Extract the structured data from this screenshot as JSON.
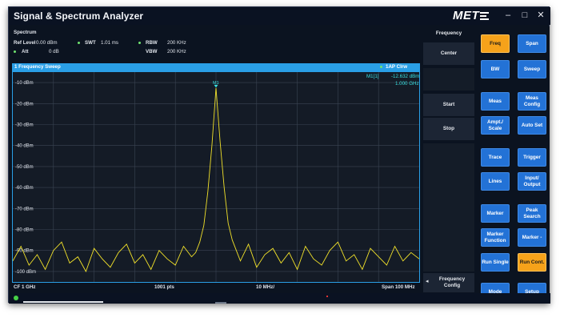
{
  "app": {
    "title": "Signal & Spectrum Analyzer",
    "logo_text": "MET"
  },
  "window_controls": {
    "minimize": "–",
    "maximize": "□",
    "close": "✕"
  },
  "info": {
    "panel_title": "Spectrum",
    "ref_level_label": "Ref Level",
    "ref_level_value": "0.00 dBm",
    "att_label": "Att",
    "att_value": "0 dB",
    "swt_label": "SWT",
    "swt_value": "1.01 ms",
    "rbw_label": "RBW",
    "rbw_value": "200 KHz",
    "vbw_label": "VBW",
    "vbw_value": "200 KHz"
  },
  "sweep": {
    "label": "1 Frequency Sweep",
    "trace_mode": "1AP Clrw"
  },
  "marker": {
    "name": "M1[1]",
    "level": "-12.632  dBm",
    "freq": "1.000  GHz",
    "tag": "M1"
  },
  "y_axis": {
    "labels": [
      "-10 dBm",
      "-20 dBm",
      "-30 dBm",
      "-40 dBm",
      "-50 dBm",
      "-60 dBm",
      "-70 dBm",
      "-80 dBm",
      "-90 dBm",
      "-100 dBm"
    ],
    "min": -105,
    "max": -5
  },
  "footer": {
    "cf": "CF  1 GHz",
    "points": "1001 pts",
    "div": "10 MHz/",
    "span": "Span  100 MHz"
  },
  "side_panel": {
    "header": "Frequency",
    "center": "Center",
    "start": "Start",
    "stop": "Stop",
    "freq_config": "Frequency Config",
    "arrow": "◂"
  },
  "buttons": [
    {
      "label": "Freq",
      "active": true
    },
    {
      "label": "Span",
      "active": false
    },
    {
      "label": "BW",
      "active": false
    },
    {
      "label": "Sweep",
      "active": false
    },
    {
      "label": "Meas",
      "active": false
    },
    {
      "label": "Meas Config",
      "active": false
    },
    {
      "label": "Ampt./ Scale",
      "active": false
    },
    {
      "label": "Auto Set",
      "active": false
    },
    {
      "label": "Trace",
      "active": false
    },
    {
      "label": "Trigger",
      "active": false
    },
    {
      "label": "Lines",
      "active": false
    },
    {
      "label": "Input/ Output",
      "active": false
    },
    {
      "label": "Marker",
      "active": false
    },
    {
      "label": "Peak Search",
      "active": false
    },
    {
      "label": "Marker Function",
      "active": false
    },
    {
      "label": "Marker -",
      "active": false
    },
    {
      "label": "Run Single",
      "active": false
    },
    {
      "label": "Run Cont.",
      "active": true
    },
    {
      "label": "Mode",
      "active": false
    },
    {
      "label": "Setup",
      "active": false
    }
  ],
  "colors": {
    "accent": "#2a9fe6",
    "trace": "#f2e22a",
    "active_button": "#f6a21a",
    "button": "#2372d6",
    "marker_text": "#39e0e0"
  },
  "chart_data": {
    "type": "line",
    "x_unit": "GHz",
    "y_unit": "dBm",
    "xlim": [
      0.95,
      1.05
    ],
    "ylim": [
      -105,
      -5
    ],
    "series": [
      {
        "x": [
          0.95,
          0.952,
          0.954,
          0.956,
          0.958,
          0.96,
          0.962,
          0.964,
          0.966,
          0.968,
          0.97,
          0.972,
          0.974,
          0.976,
          0.978,
          0.98,
          0.982,
          0.984,
          0.986,
          0.988,
          0.99,
          0.992,
          0.994,
          0.995,
          0.996,
          0.997,
          0.998,
          0.999,
          1.0,
          1.001,
          1.002,
          1.003,
          1.004,
          1.005,
          1.006,
          1.008,
          1.01,
          1.012,
          1.014,
          1.016,
          1.018,
          1.02,
          1.022,
          1.024,
          1.026,
          1.028,
          1.03,
          1.032,
          1.034,
          1.036,
          1.038,
          1.04,
          1.042,
          1.044,
          1.046,
          1.048,
          1.05
        ],
        "y": [
          -95,
          -88,
          -97,
          -92,
          -99,
          -90,
          -86,
          -96,
          -93,
          -100,
          -89,
          -94,
          -98,
          -91,
          -87,
          -96,
          -92,
          -99,
          -90,
          -94,
          -97,
          -88,
          -93,
          -91,
          -86,
          -78,
          -62,
          -40,
          -12.6,
          -38,
          -60,
          -77,
          -85,
          -90,
          -95,
          -87,
          -98,
          -92,
          -89,
          -96,
          -91,
          -99,
          -88,
          -94,
          -97,
          -90,
          -86,
          -95,
          -92,
          -99,
          -89,
          -93,
          -97,
          -88,
          -95,
          -91,
          -94
        ]
      }
    ]
  }
}
